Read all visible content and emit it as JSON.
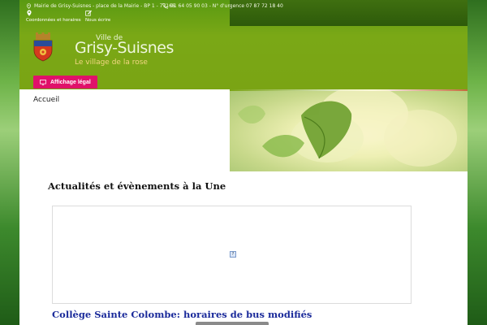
{
  "topbar": {
    "address": "Mairie de Grisy-Suisnes - place de la Mairie - BP 1 - 77166",
    "phone": "01 64 05 90 03 - N° d'urgence 07 87 72 18 40",
    "links": [
      {
        "label": "Coordonnées et horaires",
        "icon": "map-pin-icon"
      },
      {
        "label": "Nous écrire",
        "icon": "edit-icon"
      }
    ]
  },
  "logo": {
    "prefix": "Ville de",
    "name": "Grisy-Suisnes",
    "tagline": "Le village de la rose"
  },
  "legal_button": {
    "label": "Affichage légal",
    "icon": "monitor-icon"
  },
  "nav": {
    "home": "Accueil"
  },
  "news": {
    "section_title": "Actualités et évènements à la Une",
    "image_placeholder": "?",
    "article_title": "Collège Sainte Colombe: horaires de bus modifiés"
  },
  "colors": {
    "header_green": "#7aa414",
    "header_dark": "#2d5a0a",
    "accent_pink": "#e0116a",
    "article_link": "#1a2a9a",
    "tagline_gold": "#f1d680"
  }
}
